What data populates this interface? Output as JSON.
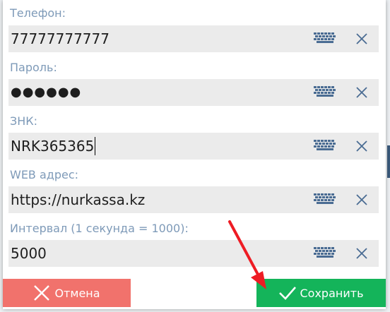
{
  "form": {
    "fields": [
      {
        "label": "Телефон:",
        "value": "77777777777",
        "type": "text"
      },
      {
        "label": "Пароль:",
        "value": "●●●●●●",
        "type": "password"
      },
      {
        "label": "ЗНК:",
        "value": "NRK365365",
        "type": "text"
      },
      {
        "label": "WEB адрес:",
        "value": "https://nurkassa.kz",
        "type": "text"
      },
      {
        "label": "Интервал (1 секунда = 1000):",
        "value": "5000",
        "type": "text"
      }
    ]
  },
  "buttons": {
    "cancel_label": "Отмена",
    "save_label": "Сохранить"
  },
  "icons": {
    "keyboard": "keyboard-icon",
    "clear": "close-icon",
    "cancel": "close-icon",
    "save": "checkmark-icon"
  },
  "colors": {
    "label": "#7e9ab8",
    "field_bg": "#ebebeb",
    "icon": "#4a6c93",
    "cancel_bg": "#f1726c",
    "save_bg": "#14b45a",
    "arrow": "#ee1c24"
  }
}
